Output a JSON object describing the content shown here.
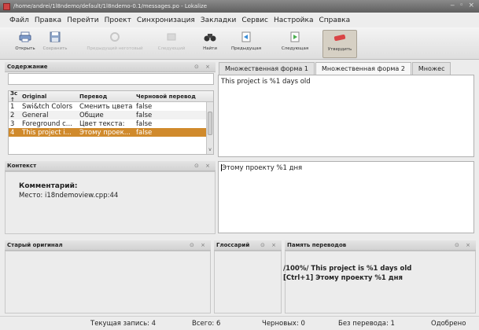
{
  "window": {
    "title": "/home/andrei/1l8ndemo/default/1l8ndemo-0.1/messages.po - Lokalize"
  },
  "menu": [
    "Файл",
    "Правка",
    "Перейти",
    "Проект",
    "Синхронизация",
    "Закладки",
    "Сервис",
    "Настройка",
    "Справка"
  ],
  "toolbar": {
    "open": "Открыть",
    "save": "Сохранить",
    "prev_fuzzy": "Предыдущий неготовый",
    "next_fuzzy": "Следующий",
    "find": "Найти",
    "previous": "Предыдущая",
    "next": "Следующая",
    "approve": "Утвердить"
  },
  "contents": {
    "title": "Содержание",
    "headers": {
      "num": "Зс ↑",
      "original": "Original",
      "translation": "Перевод",
      "draft": "Черновой перевод"
    },
    "rows": [
      {
        "num": "1",
        "original": "Swi&tch Colors",
        "translation": "Сменить цвета",
        "draft": "false"
      },
      {
        "num": "2",
        "original": "General",
        "translation": "Общие",
        "draft": "false"
      },
      {
        "num": "3",
        "original": "Foreground c...",
        "translation": "Цвет текста:",
        "draft": "false"
      },
      {
        "num": "4",
        "original": "This project i...",
        "translation": "Этому проек...",
        "draft": "false"
      }
    ],
    "scroll_arrow": "v"
  },
  "context": {
    "title": "Контекст",
    "comment_label": "Комментарий:",
    "place": "Место: i18ndemoview.cpp:44"
  },
  "tabs": [
    "Множественная форма 1",
    "Множественная форма 2",
    "Множес"
  ],
  "source_text": "This project is %1 days old",
  "target_text": "Этому проекту %1 дня",
  "old_original": {
    "title": "Старый оригинал"
  },
  "glossary": {
    "title": "Глоссарий"
  },
  "tm": {
    "title": "Память переводов",
    "line1": "/100%/ This project is %1 days old",
    "line2": "[Ctrl+1] Этому проекту %1 дня"
  },
  "status": {
    "current": "Текущая запись: 4",
    "total": "Всего: 6",
    "fuzzy": "Черновых: 0",
    "untranslated": "Без перевода: 1",
    "approved": "Одобрено"
  },
  "colors": {
    "selection": "#d08a2c",
    "titlebar": "#6e6e6e"
  },
  "dock_controls": "⊙ ×"
}
